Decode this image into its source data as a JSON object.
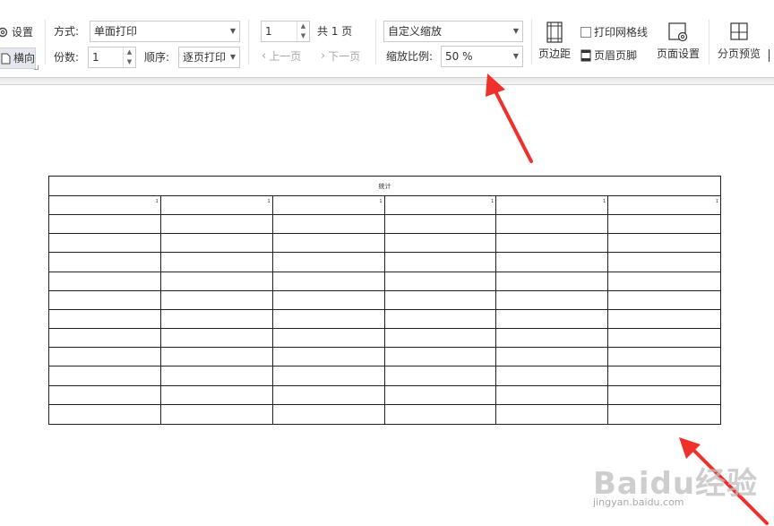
{
  "toolbar": {
    "settings_label": "设置",
    "landscape_label": "横向",
    "mode_label": "方式:",
    "mode_value": "单面打印",
    "copies_label": "份数:",
    "copies_value": "1",
    "order_label": "顺序:",
    "order_value": "逐页打印",
    "page_input_value": "1",
    "page_total": "共 1 页",
    "prev_page": "上一页",
    "next_page": "下一页",
    "zoom_mode_value": "自定义缩放",
    "zoom_ratio_label": "缩放比例:",
    "zoom_ratio_value": "50 %",
    "margin_label": "页边距",
    "print_gridlines_label": "打印网格线",
    "header_footer_label": "页眉页脚",
    "page_setup_label": "页面设置",
    "page_break_preview_label": "分页预览"
  },
  "sheet": {
    "title": "统计",
    "header_cells": [
      "1",
      "1",
      "1",
      "1",
      "1",
      "1"
    ]
  },
  "watermark": {
    "brand": "Baidu经验",
    "url": "jingyan.baidu.com"
  },
  "colors": {
    "arrow_red": "#f0302a",
    "grid_border": "#222222"
  }
}
